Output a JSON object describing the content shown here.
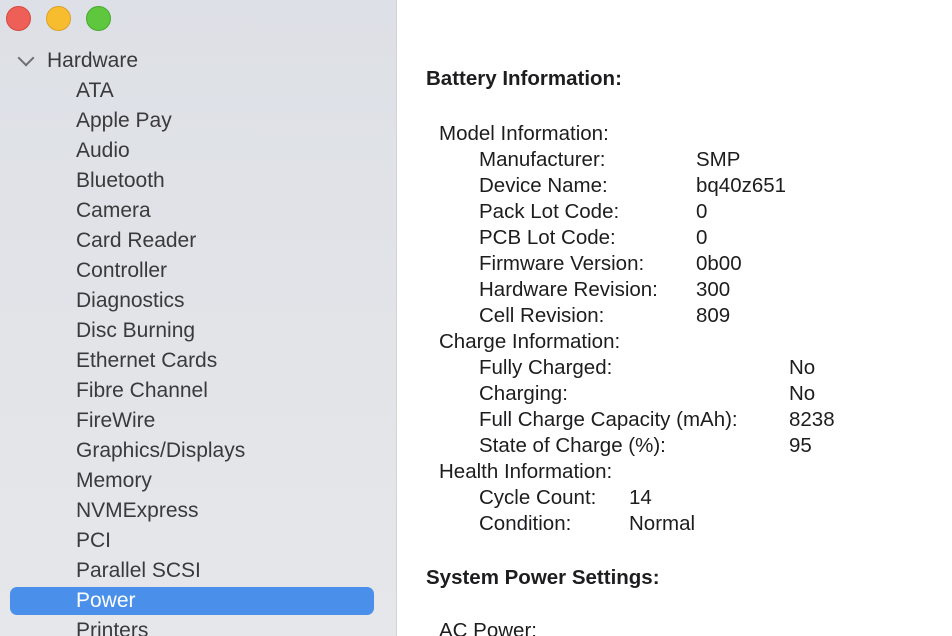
{
  "window": {
    "controls": [
      "close",
      "minimize",
      "zoom"
    ]
  },
  "sidebar": {
    "group": "Hardware",
    "items": [
      {
        "label": "ATA"
      },
      {
        "label": "Apple Pay"
      },
      {
        "label": "Audio"
      },
      {
        "label": "Bluetooth"
      },
      {
        "label": "Camera"
      },
      {
        "label": "Card Reader"
      },
      {
        "label": "Controller"
      },
      {
        "label": "Diagnostics"
      },
      {
        "label": "Disc Burning"
      },
      {
        "label": "Ethernet Cards"
      },
      {
        "label": "Fibre Channel"
      },
      {
        "label": "FireWire"
      },
      {
        "label": "Graphics/Displays"
      },
      {
        "label": "Memory"
      },
      {
        "label": "NVMExpress"
      },
      {
        "label": "PCI"
      },
      {
        "label": "Parallel SCSI"
      },
      {
        "label": "Power"
      },
      {
        "label": "Printers"
      }
    ],
    "selected": "Power",
    "selected_color": "#4a90ea"
  },
  "content": {
    "battery_title": "Battery Information:",
    "model": {
      "heading": "Model Information:",
      "fields": [
        {
          "label": "Manufacturer:",
          "value": "SMP"
        },
        {
          "label": "Device Name:",
          "value": "bq40z651"
        },
        {
          "label": "Pack Lot Code:",
          "value": "0"
        },
        {
          "label": "PCB Lot Code:",
          "value": "0"
        },
        {
          "label": "Firmware Version:",
          "value": "0b00"
        },
        {
          "label": "Hardware Revision:",
          "value": "300"
        },
        {
          "label": "Cell Revision:",
          "value": "809"
        }
      ]
    },
    "charge": {
      "heading": "Charge Information:",
      "fields": [
        {
          "label": "Fully Charged:",
          "value": "No"
        },
        {
          "label": "Charging:",
          "value": "No"
        },
        {
          "label": "Full Charge Capacity (mAh):",
          "value": "8238"
        },
        {
          "label": "State of Charge (%):",
          "value": "95"
        }
      ]
    },
    "health": {
      "heading": "Health Information:",
      "fields": [
        {
          "label": "Cycle Count:",
          "value": "14"
        },
        {
          "label": "Condition:",
          "value": "Normal"
        }
      ]
    },
    "system_title": "System Power Settings:",
    "ac_power": "AC Power:"
  }
}
